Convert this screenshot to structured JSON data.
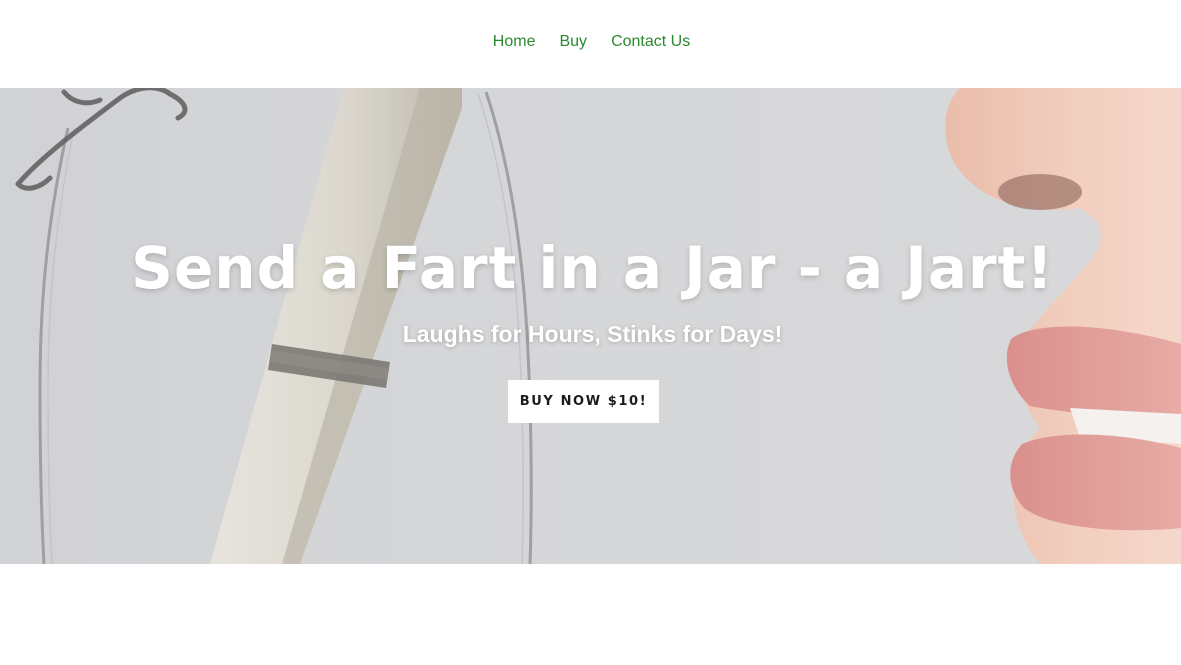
{
  "nav": {
    "items": [
      {
        "label": "Home"
      },
      {
        "label": "Buy"
      },
      {
        "label": "Contact Us"
      }
    ],
    "link_color": "#2a8a2e"
  },
  "hero": {
    "headline": "Send a Fart in a Jar - a Jart!",
    "subheadline": "Laughs for Hours, Stinks for Days!",
    "cta_label": "BUY NOW $10!",
    "background_color": "#d3d4d6",
    "image_description_icons": [
      "glass-jar-icon",
      "rolled-scroll-icon",
      "nose-and-lips-icon"
    ]
  }
}
